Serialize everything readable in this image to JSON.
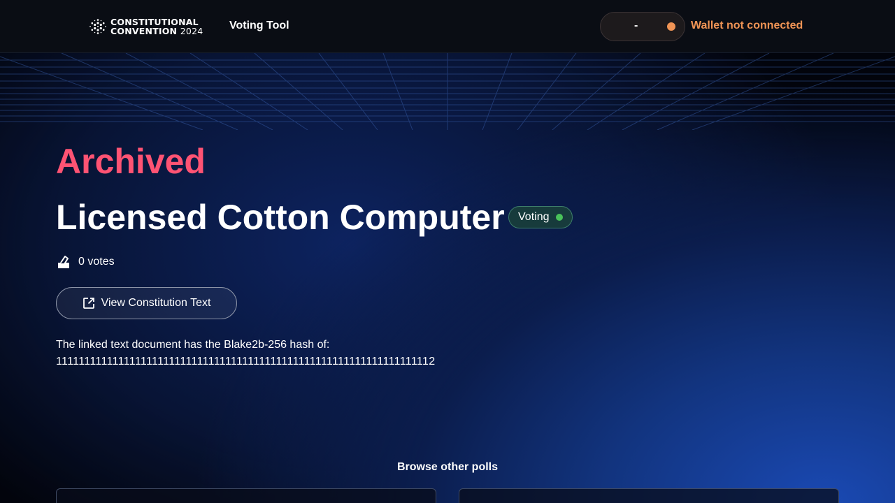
{
  "header": {
    "logo": {
      "line1": "CONSTITUTIONAL",
      "line2_word": "CONVENTION",
      "line2_year": "2024"
    },
    "nav_label": "Voting Tool",
    "wallet_pill_value": "-",
    "wallet_status": "Wallet not connected",
    "wallet_status_color": "#f09455"
  },
  "poll": {
    "state_heading": "Archived",
    "title": "Licensed Cotton Computer",
    "status_badge": "Voting",
    "votes_text": "0 votes",
    "view_button_label": "View Constitution Text",
    "hash_intro": "The linked text document has the Blake2b-256 hash of:",
    "hash_value": "1111111111111111111111111111111111111111111111111111111111111111112"
  },
  "browse": {
    "heading": "Browse other polls"
  },
  "colors": {
    "archived_accent": "#ff5373",
    "badge_dot": "#49c25a",
    "badge_bg": "#173b3c"
  },
  "icons": [
    "cardano-logo-icon",
    "ballot-box-icon",
    "external-link-icon"
  ]
}
